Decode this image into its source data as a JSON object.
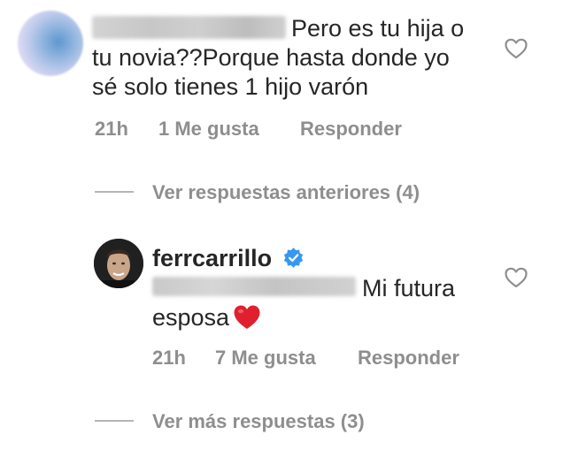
{
  "comment1": {
    "text": "Pero es tu hija o tu novia??Porque hasta donde yo sé solo tienes 1 hijo varón",
    "time": "21h",
    "likes": "1 Me gusta",
    "reply_label": "Responder"
  },
  "thread": {
    "previous_replies": "Ver respuestas anteriores (4)",
    "more_replies": "Ver más respuestas (3)"
  },
  "reply": {
    "username": "ferrcarrillo",
    "text": "Mi futura esposa",
    "time": "21h",
    "likes": "7 Me gusta",
    "reply_label": "Responder",
    "emoji": "red-heart"
  },
  "colors": {
    "text": "#262626",
    "secondary": "#8e8e8e",
    "verified": "#3897f0",
    "heart": "#e0202f"
  }
}
